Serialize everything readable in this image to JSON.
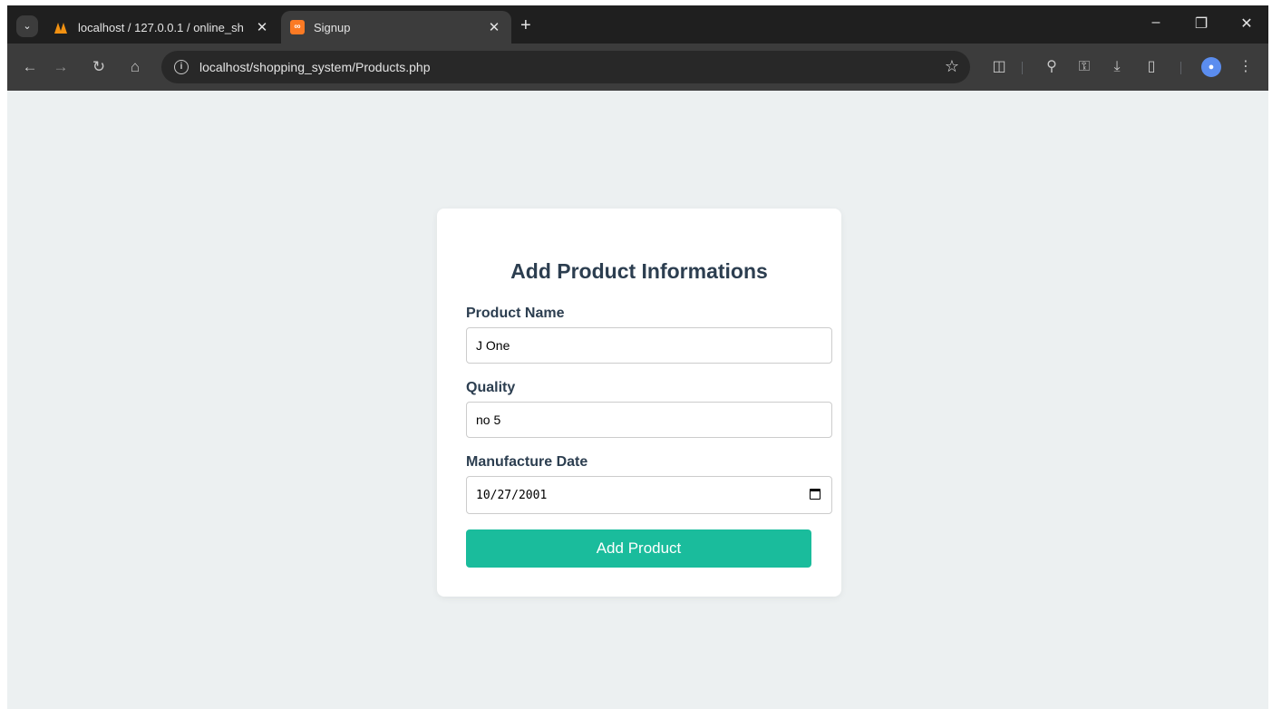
{
  "browser": {
    "tabs": [
      {
        "title": "localhost / 127.0.0.1 / online_sh",
        "active": false
      },
      {
        "title": "Signup",
        "active": true
      }
    ],
    "new_tab": "+",
    "url_host": "localhost",
    "url_path": "/shopping_system/Products.php",
    "window_controls": {
      "minimize": "–",
      "restore": "❐",
      "close": "✕"
    }
  },
  "icons": {
    "tab_search": "chevron-down-icon",
    "back": "arrow-left-icon",
    "forward": "arrow-right-icon",
    "reload": "reload-icon",
    "home": "home-icon",
    "site_info": "info-icon",
    "bookmark": "star-icon",
    "extensions": "puzzle-icon",
    "incognito": "incognito-icon",
    "passwords": "key-icon",
    "downloads": "download-icon",
    "delete": "trash-icon",
    "profile": "avatar-icon",
    "menu": "kebab-menu-icon",
    "date_picker": "calendar-icon"
  },
  "form": {
    "title": "Add Product Informations",
    "product_name_label": "Product Name",
    "product_name_value": "J One",
    "quality_label": "Quality",
    "quality_value": "no 5",
    "manufacture_date_label": "Manufacture Date",
    "manufacture_date_value": "10/27/2001",
    "submit_label": "Add Product"
  },
  "colors": {
    "page_bg": "#ecf0f1",
    "heading": "#2c3e50",
    "button": "#1abc9c",
    "favicon_xampp": "#fb7a24"
  }
}
